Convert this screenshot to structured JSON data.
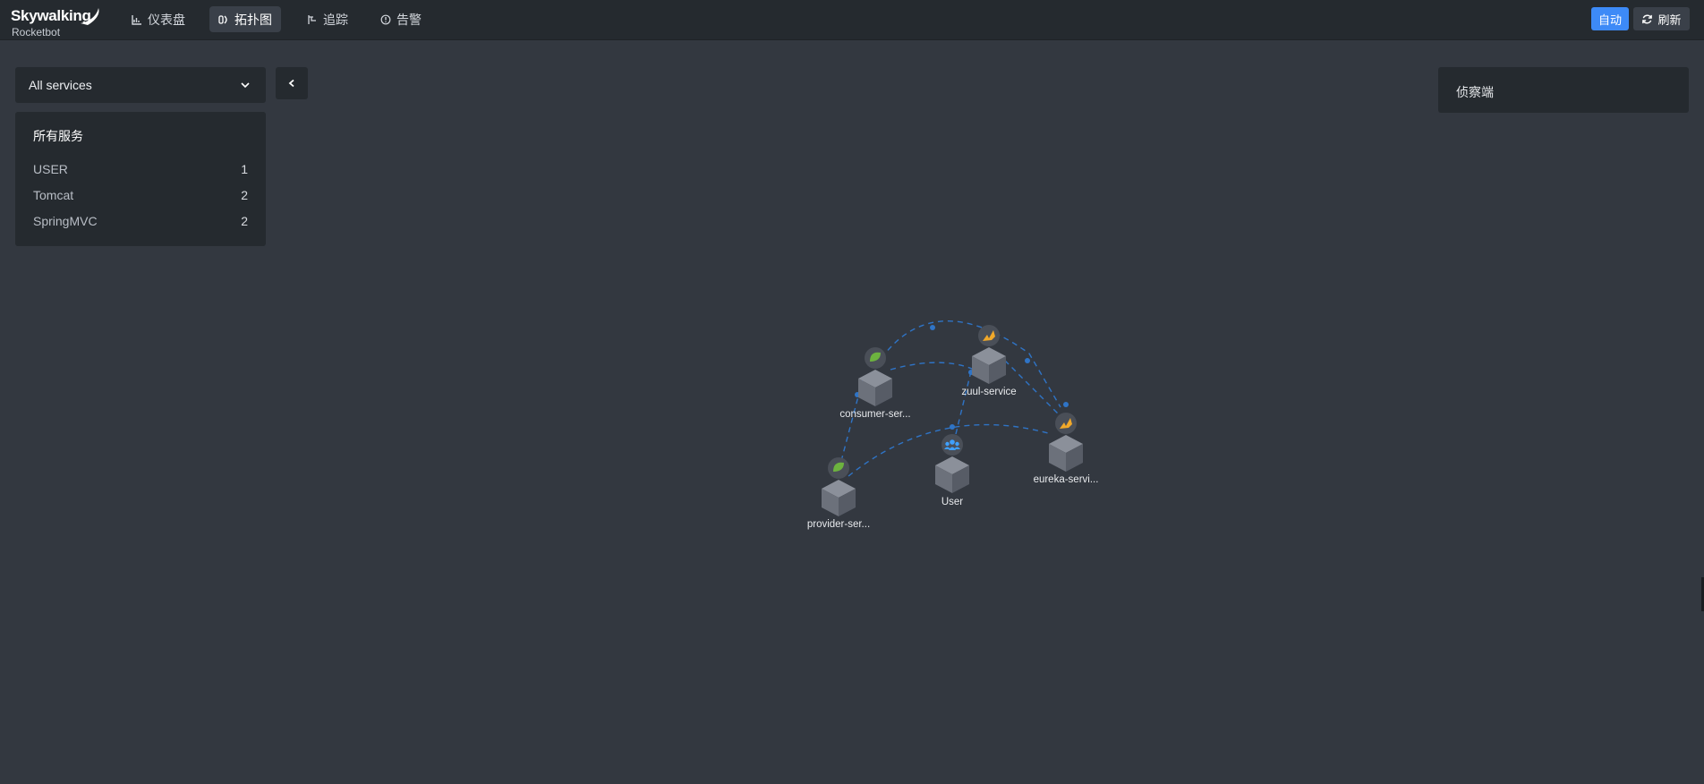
{
  "app": {
    "logo_title": "Skywalking",
    "logo_subtitle": "Rocketbot"
  },
  "nav": {
    "dashboard": "仪表盘",
    "topology": "拓扑图",
    "trace": "追踪",
    "alarm": "告警",
    "active": "topology"
  },
  "toolbar": {
    "auto_label": "自动",
    "refresh_label": "刷新"
  },
  "service_filter": {
    "selected": "All services"
  },
  "services_panel": {
    "title": "所有服务",
    "rows": [
      {
        "name": "USER",
        "count": "1"
      },
      {
        "name": "Tomcat",
        "count": "2"
      },
      {
        "name": "SpringMVC",
        "count": "2"
      }
    ]
  },
  "detector_panel": {
    "title": "侦察端"
  },
  "topology": {
    "nodes": [
      {
        "id": "consumer",
        "label": "consumer-ser...",
        "type": "spring",
        "icon": "spring-leaf-icon"
      },
      {
        "id": "zuul",
        "label": "zuul-service",
        "type": "tomcat",
        "icon": "tomcat-icon"
      },
      {
        "id": "eureka",
        "label": "eureka-servi...",
        "type": "tomcat",
        "icon": "tomcat-icon"
      },
      {
        "id": "user",
        "label": "User",
        "type": "user",
        "icon": "user-group-icon"
      },
      {
        "id": "provider",
        "label": "provider-ser...",
        "type": "spring",
        "icon": "spring-leaf-icon"
      }
    ],
    "links": [
      {
        "from": "consumer",
        "to": "eureka"
      },
      {
        "from": "consumer",
        "to": "zuul"
      },
      {
        "from": "zuul",
        "to": "eureka"
      },
      {
        "from": "user",
        "to": "zuul"
      },
      {
        "from": "provider",
        "to": "eureka"
      },
      {
        "from": "provider",
        "to": "consumer"
      }
    ]
  },
  "colors": {
    "background": "#333840",
    "panel": "#252a2f",
    "accent": "#3d8af7",
    "link": "#2f74c6",
    "spring": "#6db33f",
    "tomcat": "#f0a82a",
    "user": "#3fa0ff"
  }
}
